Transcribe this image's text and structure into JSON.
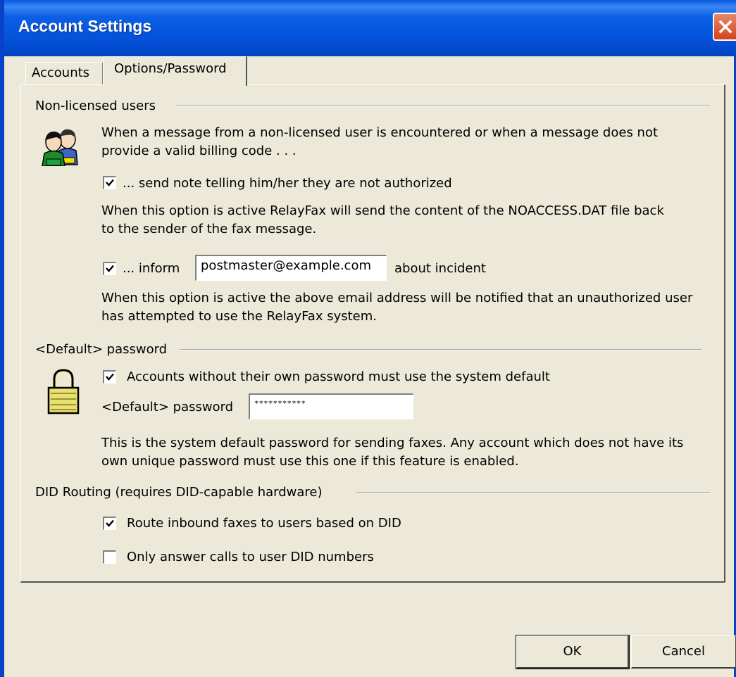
{
  "window": {
    "title": "Account Settings",
    "close_icon": "close-icon"
  },
  "tabs": [
    {
      "label": "Accounts"
    },
    {
      "label": "Options/Password"
    }
  ],
  "non_licensed": {
    "group_label": "Non-licensed users",
    "icon": "users-icon",
    "intro_line1": "When a message from a non-licensed user is encountered or when a message does not",
    "intro_line2": "provide a valid billing code . . .",
    "send_note": {
      "checked": true,
      "label": "... send note telling him/her they are not authorized"
    },
    "send_note_desc_line1": "When this option is active RelayFax will send the content of the NOACCESS.DAT file back",
    "send_note_desc_line2": "to the sender of the fax message.",
    "inform": {
      "checked": true,
      "label": "... inform",
      "email": "postmaster@example.com",
      "suffix": "about incident"
    },
    "inform_desc_line1": "When this option is active the above email address will be notified that an unauthorized user",
    "inform_desc_line2": "has attempted to use the RelayFax system."
  },
  "default_password": {
    "group_label": "<Default> password",
    "icon": "lock-icon",
    "require_default": {
      "checked": true,
      "label": "Accounts without their own password must use the system default"
    },
    "field_label": "<Default> password",
    "field_value": "***********",
    "desc_line1": "This is the system default password for sending faxes.  Any account which does not have its",
    "desc_line2": "own unique password must use this one if this feature is enabled."
  },
  "did_routing": {
    "group_label": "DID Routing (requires DID-capable hardware)",
    "route_inbound": {
      "checked": true,
      "label": "Route inbound faxes to users based on DID"
    },
    "only_answer": {
      "checked": false,
      "label": "Only answer calls to user DID numbers"
    }
  },
  "buttons": {
    "ok": "OK",
    "cancel": "Cancel"
  },
  "colors": {
    "titlebar": "#0a5ae0",
    "dialog_bg": "#ece9d8",
    "close_button": "#d3431c",
    "lock": "#e8e070"
  }
}
